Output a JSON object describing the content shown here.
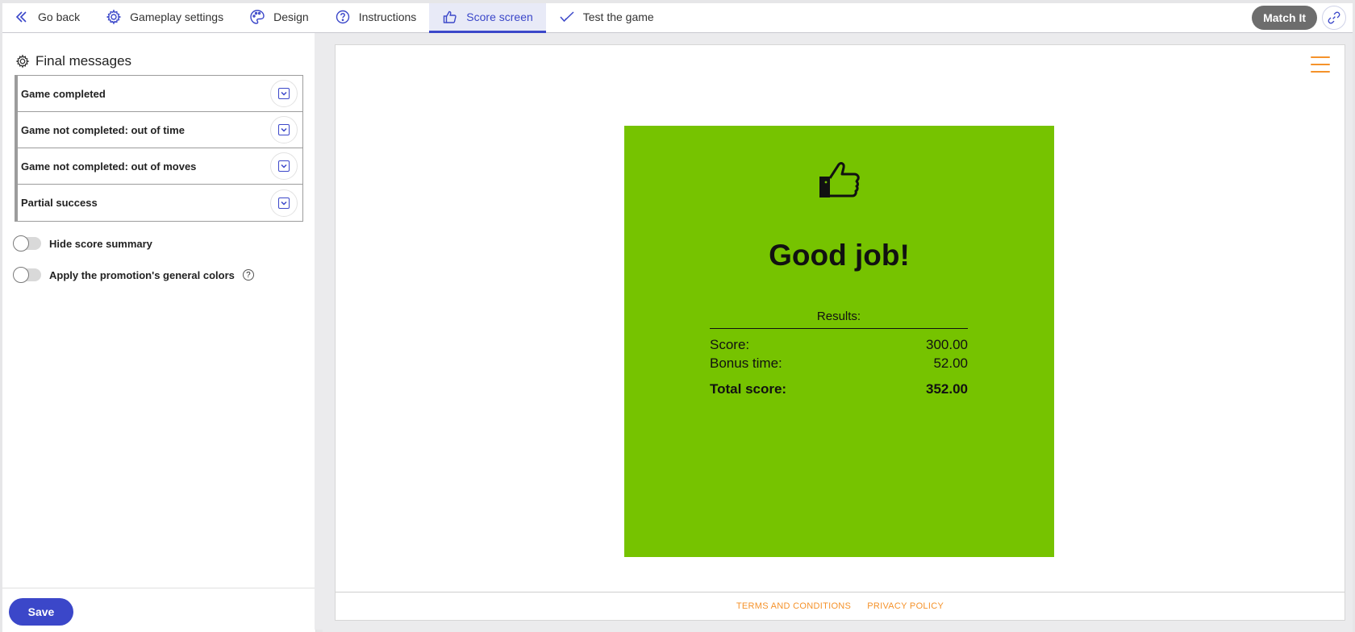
{
  "nav": {
    "back_label": "Go back",
    "tabs": [
      {
        "label": "Gameplay settings",
        "icon": "gear-icon"
      },
      {
        "label": "Design",
        "icon": "palette-icon"
      },
      {
        "label": "Instructions",
        "icon": "question-icon"
      },
      {
        "label": "Score screen",
        "icon": "thumbs-up-icon",
        "active": true
      },
      {
        "label": "Test the game",
        "icon": "check-icon"
      }
    ],
    "game_name": "Match It",
    "accent_color": "#3b47c9"
  },
  "sidebar": {
    "title": "Final messages",
    "messages": [
      {
        "label": "Game completed"
      },
      {
        "label": "Game not completed: out of time"
      },
      {
        "label": "Game not completed: out of moves"
      },
      {
        "label": "Partial success"
      }
    ],
    "toggles": [
      {
        "label": "Hide score summary",
        "on": false
      },
      {
        "label": "Apply the promotion's general colors",
        "on": false
      }
    ],
    "save_label": "Save"
  },
  "preview": {
    "card_color": "#76c300",
    "headline": "Good job!",
    "results_label": "Results:",
    "rows": [
      {
        "label": "Score:",
        "value": "300.00"
      },
      {
        "label": "Bonus time:",
        "value": "52.00"
      }
    ],
    "total": {
      "label": "Total score:",
      "value": "352.00"
    },
    "footer": {
      "terms": "TERMS AND CONDITIONS",
      "privacy": "PRIVACY POLICY"
    },
    "menu_color": "#f5922a"
  }
}
